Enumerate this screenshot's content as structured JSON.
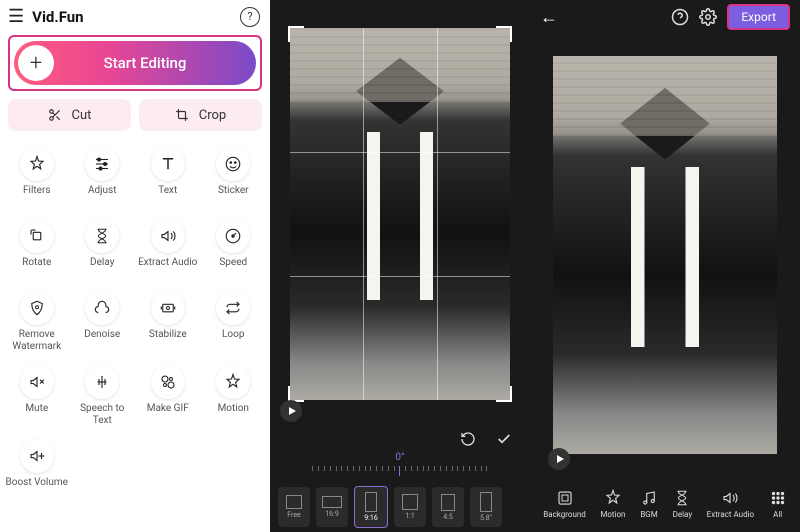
{
  "app": {
    "title": "Vid.Fun"
  },
  "left": {
    "start_label": "Start Editing",
    "cut_label": "Cut",
    "crop_label": "Crop",
    "tools": [
      {
        "icon": "filters",
        "label": "Filters"
      },
      {
        "icon": "adjust",
        "label": "Adjust"
      },
      {
        "icon": "text",
        "label": "Text"
      },
      {
        "icon": "sticker",
        "label": "Sticker"
      },
      {
        "icon": "rotate",
        "label": "Rotate"
      },
      {
        "icon": "delay",
        "label": "Delay"
      },
      {
        "icon": "extract-audio",
        "label": "Extract Audio"
      },
      {
        "icon": "speed",
        "label": "Speed"
      },
      {
        "icon": "remove-watermark",
        "label": "Remove Watermark"
      },
      {
        "icon": "denoise",
        "label": "Denoise"
      },
      {
        "icon": "stabilize",
        "label": "Stabilize"
      },
      {
        "icon": "loop",
        "label": "Loop"
      },
      {
        "icon": "mute",
        "label": "Mute"
      },
      {
        "icon": "speech-to-text",
        "label": "Speech to Text"
      },
      {
        "icon": "make-gif",
        "label": "Make GIF"
      },
      {
        "icon": "motion",
        "label": "Motion"
      },
      {
        "icon": "boost-volume",
        "label": "Boost Volume"
      }
    ]
  },
  "mid": {
    "rotation_value": "0°",
    "ratios": [
      {
        "label": "Free",
        "w": 14,
        "h": 12,
        "selected": false
      },
      {
        "label": "16:9",
        "w": 18,
        "h": 10,
        "selected": false
      },
      {
        "label": "9:16",
        "w": 10,
        "h": 18,
        "selected": true,
        "icon": "tiktok"
      },
      {
        "label": "1:1",
        "w": 14,
        "h": 14,
        "selected": false,
        "icon": "instagram"
      },
      {
        "label": "4:5",
        "w": 12,
        "h": 15,
        "selected": false,
        "icon": "instagram"
      },
      {
        "label": "5.8\"",
        "w": 10,
        "h": 18,
        "selected": false,
        "icon": "apple"
      }
    ]
  },
  "right": {
    "export_label": "Export",
    "tools": [
      {
        "icon": "background",
        "label": "Background"
      },
      {
        "icon": "motion",
        "label": "Motion"
      },
      {
        "icon": "bgm",
        "label": "BGM"
      },
      {
        "icon": "delay",
        "label": "Delay"
      },
      {
        "icon": "extract-audio",
        "label": "Extract Audio"
      },
      {
        "icon": "all",
        "label": "All"
      }
    ]
  }
}
